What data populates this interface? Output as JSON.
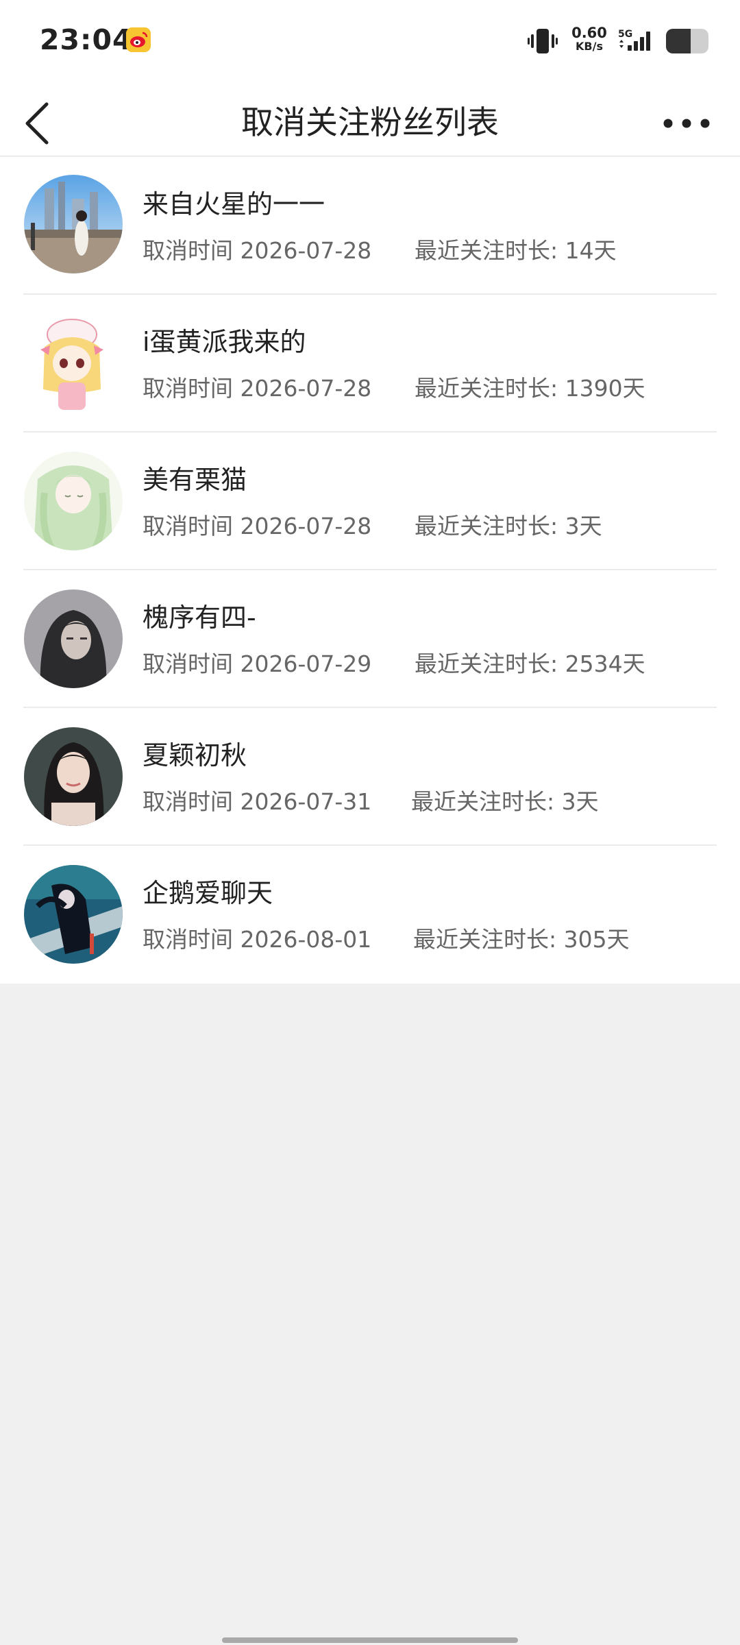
{
  "status_bar": {
    "time": "23:04",
    "net_speed_value": "0.60",
    "net_speed_unit": "KB/s",
    "network_type": "5G",
    "app_icon": "weibo-icon"
  },
  "header": {
    "title": "取消关注粉丝列表",
    "back_icon": "chevron-left-icon",
    "more_icon": "more-horizontal-icon"
  },
  "list": {
    "items": [
      {
        "name": "来自火星的一一",
        "cancel_label": "取消时间 2026-07-28",
        "duration_label": "最近关注时长: 14天"
      },
      {
        "name": "i蛋黄派我来的",
        "cancel_label": "取消时间 2026-07-28",
        "duration_label": "最近关注时长: 1390天"
      },
      {
        "name": "美有栗猫",
        "cancel_label": "取消时间 2026-07-28",
        "duration_label": "最近关注时长: 3天"
      },
      {
        "name": "槐序有四-",
        "cancel_label": "取消时间 2026-07-29",
        "duration_label": "最近关注时长: 2534天"
      },
      {
        "name": "夏颖初秋",
        "cancel_label": "取消时间 2026-07-31",
        "duration_label": "最近关注时长: 3天"
      },
      {
        "name": "企鹅爱聊天",
        "cancel_label": "取消时间 2026-08-01",
        "duration_label": "最近关注时长: 305天"
      }
    ]
  },
  "colors": {
    "background": "#f0f0f0",
    "card": "#ffffff",
    "primary_text": "#222222",
    "secondary_text": "#666666",
    "divider": "#ebebeb"
  }
}
